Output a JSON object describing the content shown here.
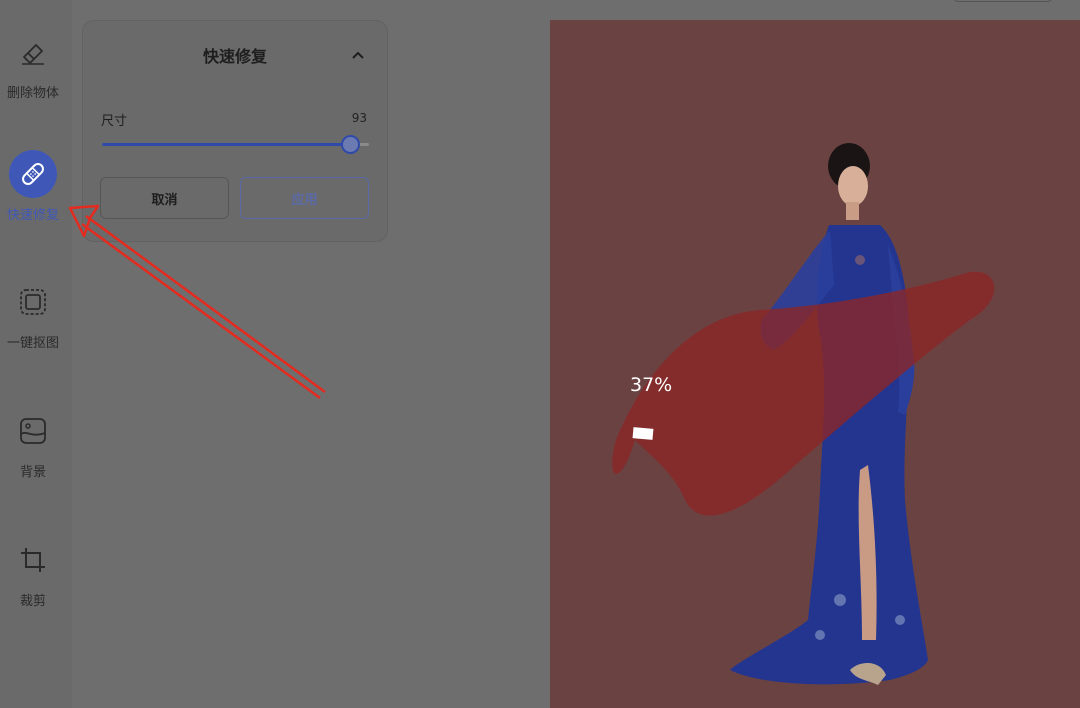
{
  "sidebar": {
    "items": [
      {
        "label": "删除物体",
        "icon": "eraser-icon"
      },
      {
        "label": "快速修复",
        "icon": "bandage-icon",
        "active": true
      },
      {
        "label": "一键抠图",
        "icon": "cutout-icon"
      },
      {
        "label": "背景",
        "icon": "image-icon"
      },
      {
        "label": "裁剪",
        "icon": "crop-icon"
      }
    ]
  },
  "panel": {
    "title": "快速修复",
    "size_label": "尺寸",
    "size_value": "93",
    "slider_fraction": 0.93,
    "cancel_label": "取消",
    "apply_label": "应用"
  },
  "canvas": {
    "progress_text": "37%",
    "progress_fraction": 0.37
  },
  "colors": {
    "accent": "#3f58b8",
    "mask": "#8b2727",
    "arrow": "#e52a1f"
  }
}
